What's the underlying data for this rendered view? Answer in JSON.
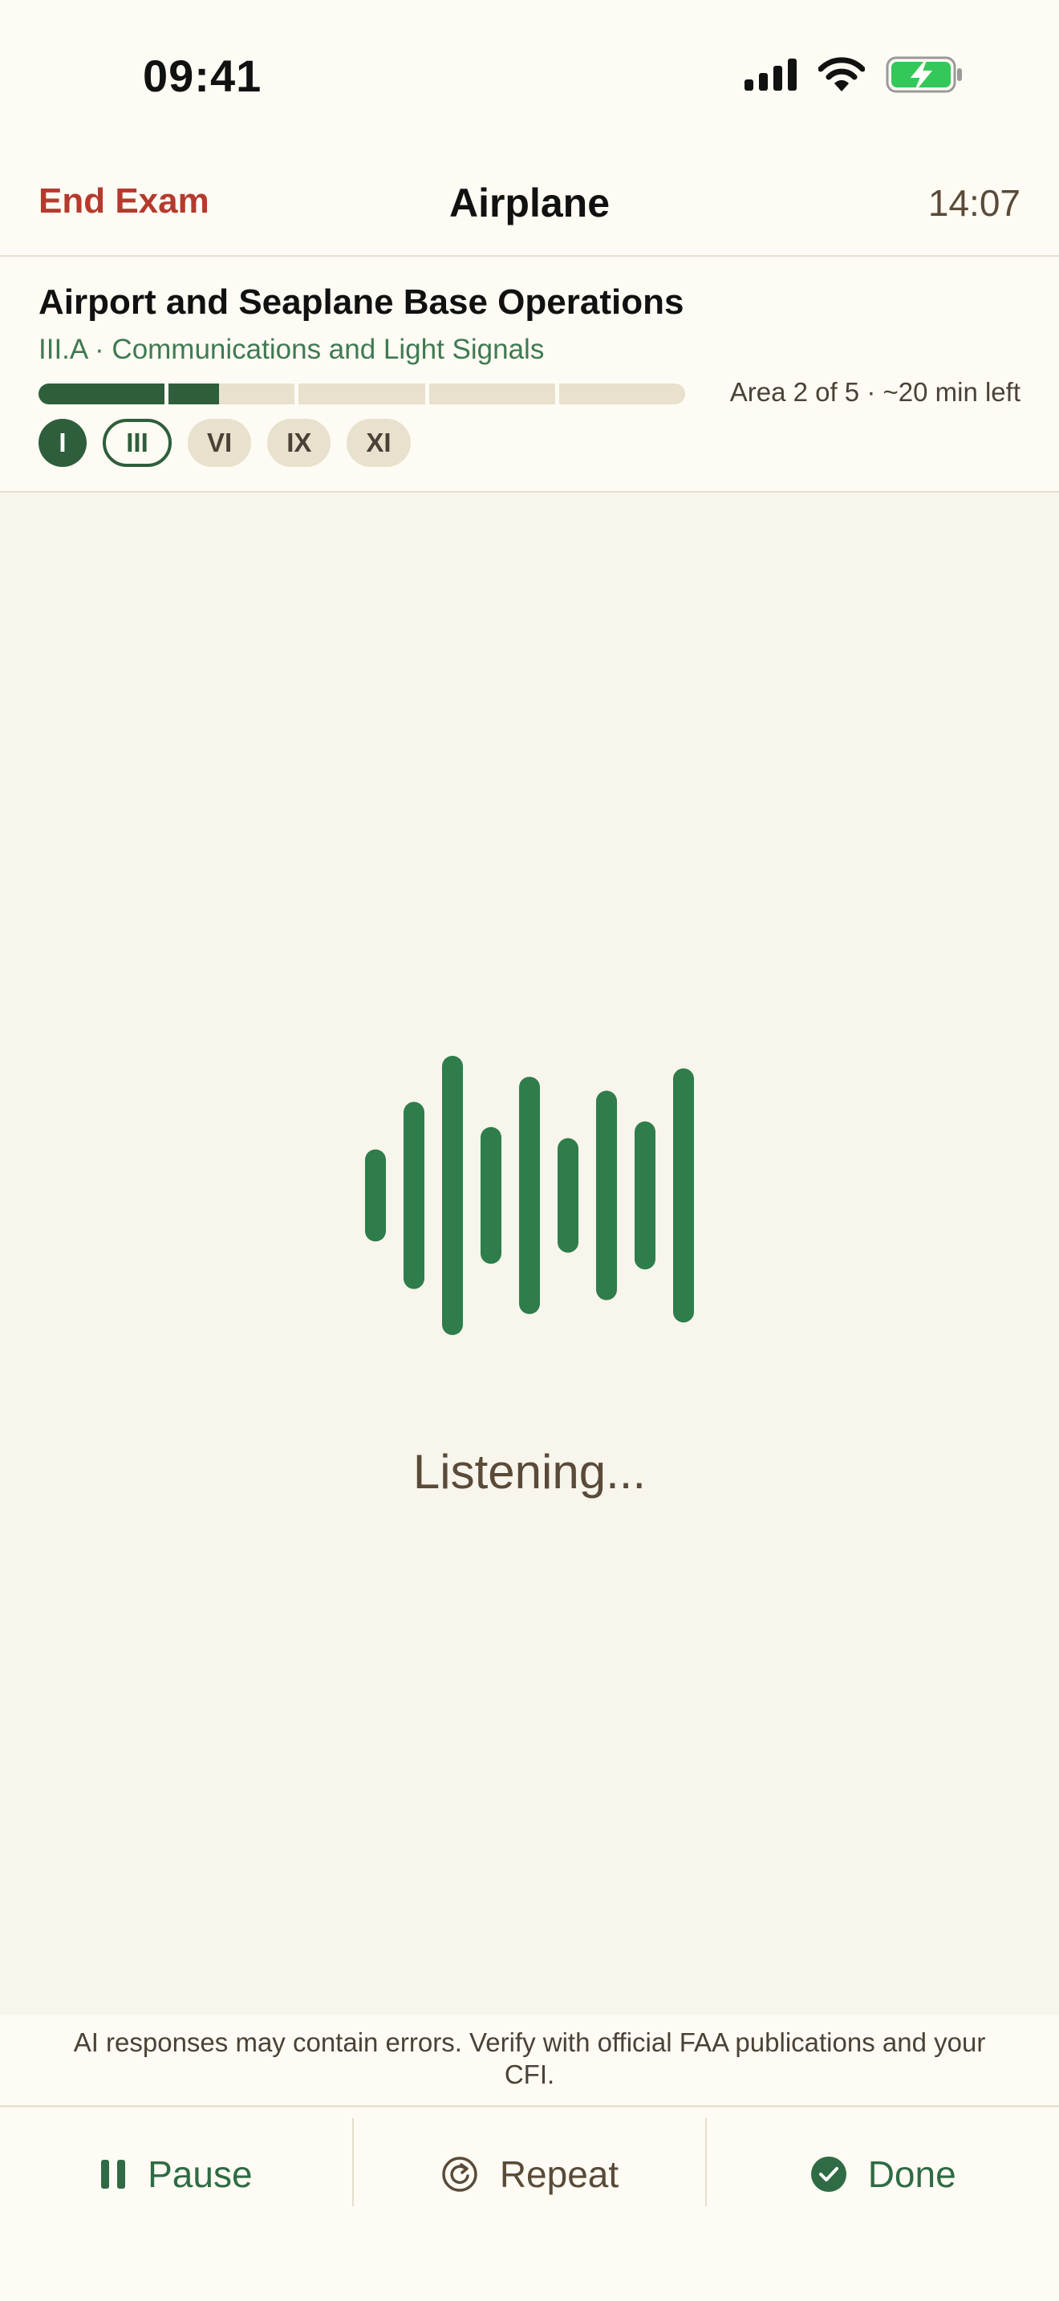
{
  "status_bar": {
    "time": "09:41",
    "icons": [
      "cellular-signal-icon",
      "wifi-icon",
      "battery-charging-icon"
    ]
  },
  "nav": {
    "end_exam": "End Exam",
    "title": "Airplane",
    "timer": "14:07"
  },
  "exam": {
    "area_title": "Airport and Seaplane Base Operations",
    "task": "III.A · Communications and Light Signals",
    "progress_text": "Area 2 of 5 · ~20 min left",
    "progress_segments": [
      1,
      0.4,
      0,
      0,
      0
    ],
    "areas": [
      {
        "label": "I",
        "state": "done"
      },
      {
        "label": "III",
        "state": "current"
      },
      {
        "label": "VI",
        "state": "pending"
      },
      {
        "label": "IX",
        "state": "pending"
      },
      {
        "label": "XI",
        "state": "pending"
      }
    ]
  },
  "voice": {
    "status": "Listening...",
    "wave_levels": [
      0.33,
      0.67,
      1.0,
      0.49,
      0.85,
      0.41,
      0.75,
      0.53,
      0.91
    ],
    "wave_color": "#2e7d4a"
  },
  "disclaimer": "AI responses may contain errors. Verify with official FAA publications and your CFI.",
  "toolbar": {
    "pause_label": "Pause",
    "repeat_label": "Repeat",
    "done_label": "Done"
  },
  "colors": {
    "accent": "#2f5e3c",
    "danger": "#b53a2e",
    "background": "#f8f5ec"
  }
}
